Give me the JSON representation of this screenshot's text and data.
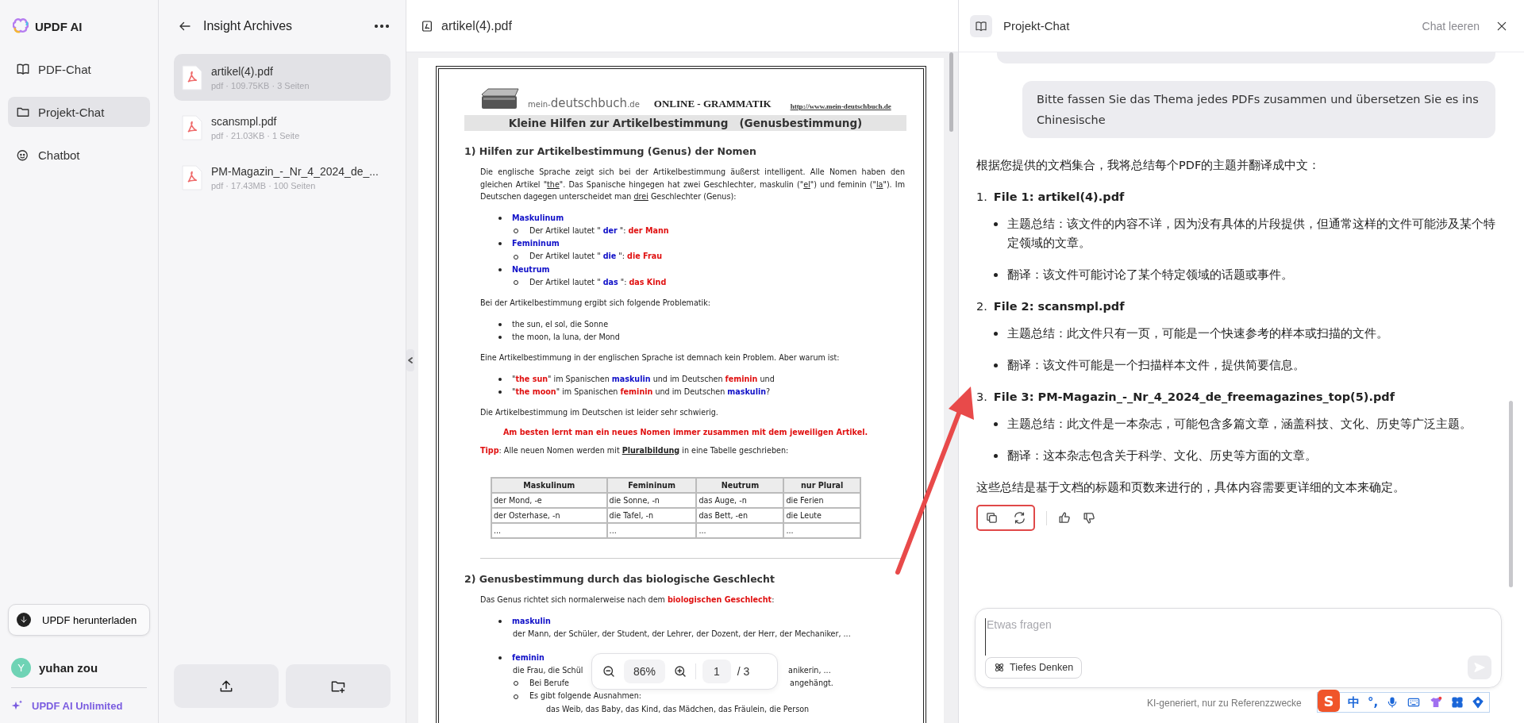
{
  "app": {
    "name": "UPDF AI"
  },
  "nav": [
    {
      "label": "PDF-Chat",
      "selected": false,
      "kind": "book"
    },
    {
      "label": "Projekt-Chat",
      "selected": true,
      "kind": "folder"
    },
    {
      "label": "Chatbot",
      "selected": false,
      "kind": "bot"
    }
  ],
  "download_button": "UPDF herunterladen",
  "user": {
    "initial": "Y",
    "name": "yuhan zou"
  },
  "plan_link": "UPDF AI Unlimited",
  "project": {
    "title": "Insight Archives",
    "files": [
      {
        "name": "artikel(4).pdf",
        "meta": "pdf · 109.75KB · 3 Seiten",
        "selected": true
      },
      {
        "name": "scansmpl.pdf",
        "meta": "pdf · 21.03KB · 1 Seite",
        "selected": false
      },
      {
        "name": "PM-Magazin_-_Nr_4_2024_de_...",
        "meta": "pdf · 17.43MB · 100 Seiten",
        "selected": false
      }
    ]
  },
  "viewer": {
    "filename": "artikel(4).pdf",
    "zoom": "86%",
    "page": "1",
    "total": "/ 3"
  },
  "document": {
    "logo": [
      {
        "text": "mein-",
        "kind": "prefix"
      },
      {
        "text": "deutschbuch",
        "kind": "name"
      },
      {
        "text": ".de",
        "kind": "suffix"
      }
    ],
    "header_title": "ONLINE - GRAMMATIK",
    "header_link": "http://www.mein-deutschbuch.de",
    "blocks": [
      {
        "kind": "title",
        "spans": [
          "Kleine Hilfen zur Artikelbestimmung   (Genusbestimmung)"
        ]
      },
      {
        "kind": "heading",
        "spans": [
          "1) Hilfen zur Artikelbestimmung (Genus) der Nomen"
        ]
      },
      {
        "kind": "para",
        "spans": [
          "Die englische Sprache zeigt sich bei der Artikelbestimmung äußerst intelligent. Alle Nomen haben den gleichen Artikel \"",
          {
            "text": "the",
            "kind": "underlined"
          },
          "\". Das Spanische hingegen hat zwei Geschlechter, maskulin (\"",
          {
            "text": "el",
            "kind": "underlined"
          },
          "\") und feminin (\"",
          {
            "text": "la",
            "kind": "underlined"
          },
          "\"). Im Deutschen dagegen unterscheidet man ",
          {
            "text": "drei",
            "kind": "underlined"
          },
          " Geschlechter (Genus):"
        ]
      },
      {
        "kind": "bullet",
        "spans": [
          {
            "text": "Maskulinum",
            "kind": "term"
          }
        ]
      },
      {
        "kind": "sub",
        "spans": [
          "Der Artikel lautet \" ",
          {
            "text": "der",
            "kind": "term"
          },
          " \": ",
          {
            "text": "der Mann",
            "kind": "highlight"
          }
        ]
      },
      {
        "kind": "bullet",
        "spans": [
          {
            "text": "Femininum",
            "kind": "term"
          }
        ]
      },
      {
        "kind": "sub",
        "spans": [
          "Der Artikel lautet \" ",
          {
            "text": "die",
            "kind": "term"
          },
          " \": ",
          {
            "text": "die Frau",
            "kind": "highlight"
          }
        ]
      },
      {
        "kind": "bullet",
        "spans": [
          {
            "text": "Neutrum",
            "kind": "term"
          }
        ]
      },
      {
        "kind": "sub",
        "spans": [
          "Der Artikel lautet \" ",
          {
            "text": "das",
            "kind": "term"
          },
          " \": ",
          {
            "text": "das Kind",
            "kind": "highlight"
          }
        ]
      },
      {
        "kind": "para",
        "spans": [
          "Bei der Artikelbestimmung ergibt sich folgende Problematik:"
        ]
      },
      {
        "kind": "bullet",
        "spans": [
          "the sun, el sol, die Sonne"
        ]
      },
      {
        "kind": "bullet",
        "spans": [
          "the moon, la luna, der Mond"
        ]
      },
      {
        "kind": "para",
        "spans": [
          "Eine Artikelbestimmung in der englischen Sprache ist demnach kein Problem. Aber warum ist:"
        ]
      },
      {
        "kind": "bullet",
        "spans": [
          "\"",
          {
            "text": "the sun",
            "kind": "highlight"
          },
          "\" im Spanischen ",
          {
            "text": "maskulin",
            "kind": "term"
          },
          " und im Deutschen ",
          {
            "text": "feminin",
            "kind": "highlight"
          },
          " und"
        ]
      },
      {
        "kind": "bullet",
        "spans": [
          "\"",
          {
            "text": "the moon",
            "kind": "highlight"
          },
          "\" im Spanischen ",
          {
            "text": "feminin",
            "kind": "highlight"
          },
          " und im Deutschen ",
          {
            "text": "maskulin",
            "kind": "term"
          },
          "?"
        ]
      },
      {
        "kind": "para",
        "spans": [
          "Die Artikelbestimmung im Deutschen ist leider sehr schwierig."
        ]
      },
      {
        "kind": "center",
        "spans": [
          {
            "text": "Am besten lernt man ein neues Nomen immer zusammen mit dem jeweiligen Artikel.",
            "kind": "highlight"
          }
        ]
      },
      {
        "kind": "para",
        "spans": [
          {
            "text": "Tipp",
            "kind": "highlight"
          },
          ": Alle neuen Nomen werden mit ",
          {
            "text": "Pluralbildung",
            "kind": "keyword"
          },
          " in eine Tabelle geschrieben:"
        ]
      },
      {
        "kind": "table",
        "columns": [
          "Maskulinum",
          "Femininum",
          "Neutrum",
          "nur Plural"
        ],
        "rows": [
          [
            "der Mond, -e",
            "die Sonne, -n",
            "das Auge, -n",
            "die Ferien"
          ],
          [
            "der Osterhase, -n",
            "die Tafel, -n",
            "das Bett, -en",
            "die Leute"
          ],
          [
            "...",
            "...",
            "...",
            "..."
          ]
        ]
      },
      {
        "kind": "rule"
      },
      {
        "kind": "heading",
        "spans": [
          "2) Genusbestimmung durch das biologische Geschlecht"
        ]
      },
      {
        "kind": "para",
        "spans": [
          "Das Genus richtet sich normalerweise nach dem ",
          {
            "text": "biologischen Geschlecht",
            "kind": "highlight"
          },
          ":"
        ]
      },
      {
        "kind": "bullet",
        "spans": [
          {
            "text": "maskulin",
            "kind": "term"
          }
        ]
      },
      {
        "kind": "cont",
        "spans": [
          "der Mann, der Schüler, der Student, der Lehrer, der Dozent, der Herr, der Mechaniker, ..."
        ]
      },
      {
        "kind": "bullet",
        "spans": [
          {
            "text": "feminin",
            "kind": "term"
          }
        ]
      },
      {
        "kind": "cont",
        "parts": [
          [
            "die Frau, die Schül"
          ],
          [
            "anikerin, ..."
          ]
        ]
      },
      {
        "kind": "sub",
        "parts": [
          [
            "Bei Berufe"
          ],
          [
            "angehängt."
          ]
        ]
      },
      {
        "kind": "sub",
        "spans": [
          "Es gibt folgende Ausnahmen:"
        ]
      },
      {
        "kind": "subcont",
        "spans": [
          "das Weib, das Baby, das Kind, das Mädchen, das Fräulein, die Person"
        ]
      }
    ]
  },
  "chat": {
    "title": "Projekt-Chat",
    "clear_button": "Chat leeren",
    "user_message": "Bitte fassen Sie das Thema jedes PDFs zusammen und übersetzen Sie es ins Chinesische",
    "answer": {
      "intro": "根据您提供的文档集合，我将总结每个PDF的主题并翻译成中文：",
      "files": [
        {
          "number": "1.",
          "title": "File 1: artikel(4).pdf",
          "points": [
            "主题总结：该文件的内容不详，因为没有具体的片段提供，但通常这样的文件可能涉及某个特定领域的文章。",
            "翻译：该文件可能讨论了某个特定领域的话题或事件。"
          ]
        },
        {
          "number": "2.",
          "title": "File 2: scansmpl.pdf",
          "points": [
            "主题总结：此文件只有一页，可能是一个快速参考的样本或扫描的文件。",
            "翻译：该文件可能是一个扫描样本文件，提供简要信息。"
          ]
        },
        {
          "number": "3.",
          "title": "File 3: PM-Magazin_-_Nr_4_2024_de_freemagazines_top(5).pdf",
          "points": [
            "主题总结：此文件是一本杂志，可能包含多篇文章，涵盖科技、文化、历史等广泛主题。",
            "翻译：这本杂志包含关于科学、文化、历史等方面的文章。"
          ]
        }
      ],
      "conclusion": "这些总结是基于文档的标题和页数来进行的，具体内容需要更详细的文本来确定。"
    },
    "input": {
      "placeholder": "Etwas fragen",
      "deep_button": "Tiefes Denken"
    },
    "footnote": "KI-generiert, nur zu Referenzzwecke"
  },
  "ime": {
    "logo": "S",
    "mode": "中",
    "punct": "°,"
  }
}
